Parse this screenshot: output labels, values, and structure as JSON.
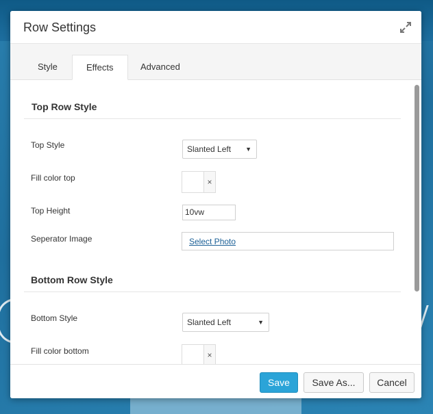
{
  "modal": {
    "title": "Row Settings",
    "expand_icon": "expand-arrows-icon"
  },
  "tabs": [
    {
      "label": "Style",
      "active": false
    },
    {
      "label": "Effects",
      "active": true
    },
    {
      "label": "Advanced",
      "active": false
    }
  ],
  "top_section": {
    "title": "Top Row Style",
    "top_style_label": "Top Style",
    "top_style_value": "Slanted Left",
    "fill_color_label": "Fill color top",
    "top_height_label": "Top Height",
    "top_height_value": "10vw",
    "separator_image_label": "Seperator Image",
    "select_photo_link": "Select Photo"
  },
  "bottom_section": {
    "title": "Bottom Row Style",
    "bottom_style_label": "Bottom Style",
    "bottom_style_value": "Slanted Left",
    "fill_color_label": "Fill color bottom"
  },
  "icons": {
    "clear": "×",
    "caret": "▼"
  },
  "footer": {
    "save_label": "Save",
    "save_as_label": "Save As...",
    "cancel_label": "Cancel"
  },
  "colors": {
    "primary_button": "#2ba4d8",
    "link": "#1a5f96"
  }
}
